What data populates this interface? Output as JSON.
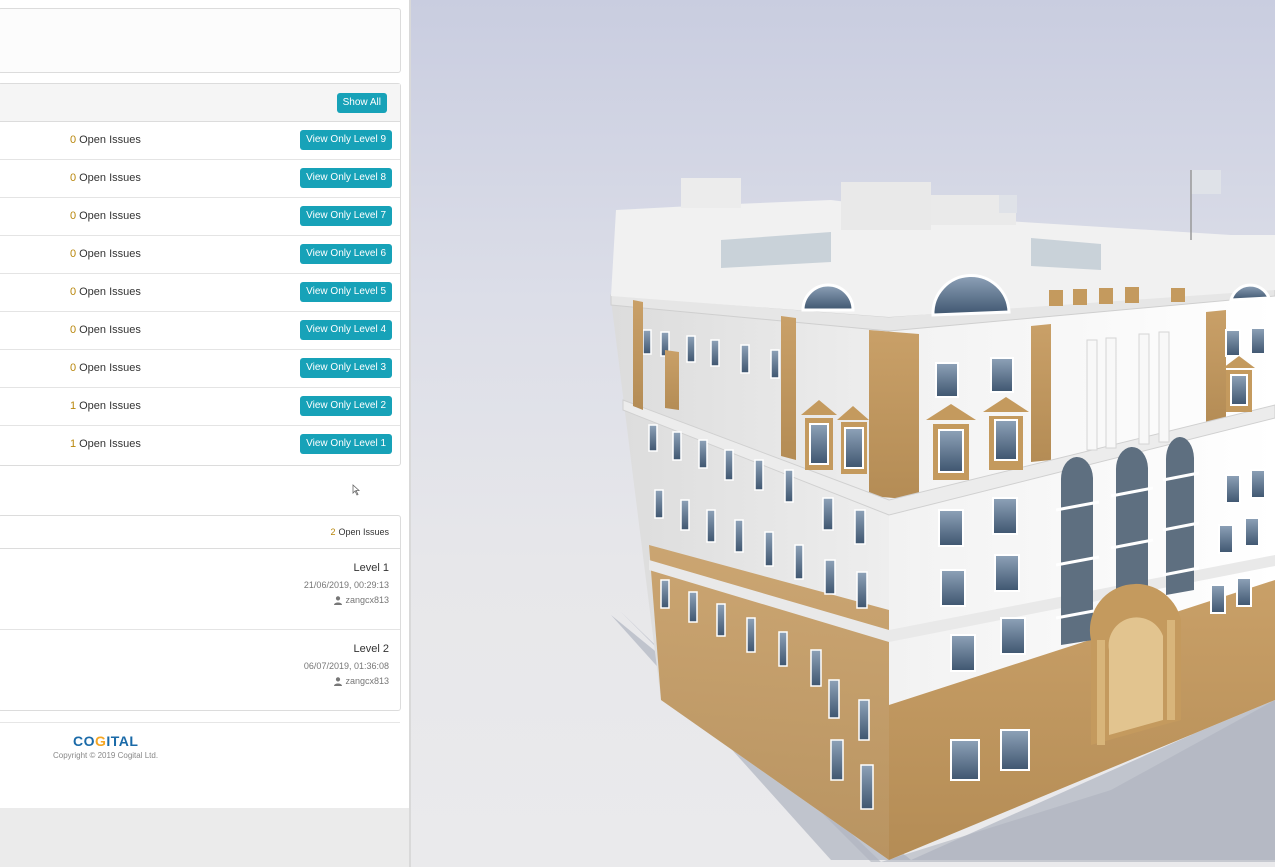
{
  "levels_panel": {
    "show_all_label": "Show All",
    "rows": [
      {
        "count": "0",
        "issues_label": "Open Issues",
        "button_label": "View Only Level 9"
      },
      {
        "count": "0",
        "issues_label": "Open Issues",
        "button_label": "View Only Level 8"
      },
      {
        "count": "0",
        "issues_label": "Open Issues",
        "button_label": "View Only Level 7"
      },
      {
        "count": "0",
        "issues_label": "Open Issues",
        "button_label": "View Only Level 6"
      },
      {
        "count": "0",
        "issues_label": "Open Issues",
        "button_label": "View Only Level 5"
      },
      {
        "count": "0",
        "issues_label": "Open Issues",
        "button_label": "View Only Level 4"
      },
      {
        "count": "0",
        "issues_label": "Open Issues",
        "button_label": "View Only Level 3"
      },
      {
        "count": "1",
        "issues_label": "Open Issues",
        "button_label": "View Only Level 2"
      },
      {
        "count": "1",
        "issues_label": "Open Issues",
        "button_label": "View Only Level 1"
      }
    ]
  },
  "issues_panel": {
    "count": "2",
    "count_label": "Open Issues",
    "items": [
      {
        "level": "Level 1",
        "datetime": "21/06/2019, 00:29:13",
        "user": "zangcx813"
      },
      {
        "level": "Level 2",
        "datetime": "06/07/2019, 01:36:08",
        "user": "zangcx813"
      }
    ]
  },
  "footer": {
    "logo_part1": "CO",
    "logo_accent": "G",
    "logo_part2": "ITAL",
    "copyright": "Copyright © 2019 Cogital Ltd."
  },
  "colors": {
    "button": "#17a2b8",
    "count_highlight": "#b8860b",
    "logo_blue": "#1a6aa8",
    "logo_orange": "#f5a623",
    "facade_tan": "#c49a5e",
    "facade_white": "#f7f7f7"
  },
  "icons": {
    "user": "user-icon",
    "cursor": "cursor-icon"
  }
}
